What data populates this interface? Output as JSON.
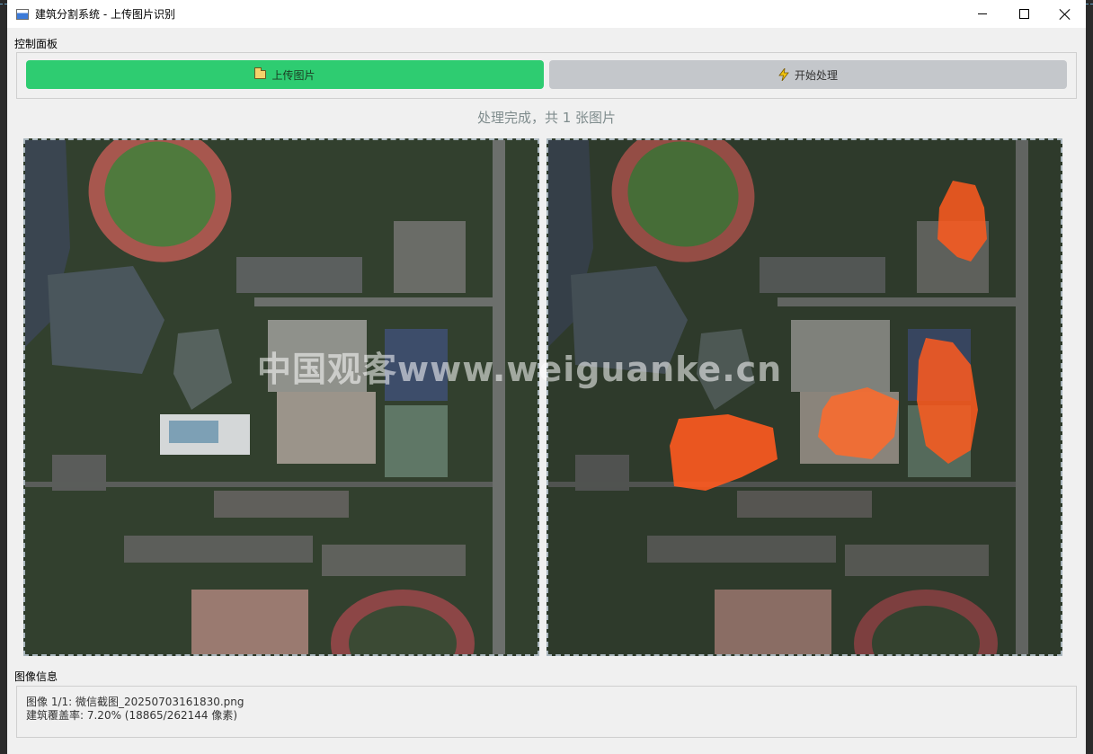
{
  "window": {
    "title": "建筑分割系统 - 上传图片识别",
    "minimize_glyph": "",
    "maximize_glyph": "",
    "close_glyph": ""
  },
  "control_panel": {
    "label": "控制面板",
    "upload_button": {
      "label": "上传图片",
      "icon": "folder-icon",
      "color": "#2ecc71"
    },
    "process_button": {
      "label": "开始处理",
      "icon": "lightning-icon",
      "color": "#c4c7cb"
    }
  },
  "status": {
    "text": "处理完成，共 1 张图片"
  },
  "images": {
    "original": {
      "kind": "satellite-image"
    },
    "segmented": {
      "kind": "satellite-image-with-building-overlay",
      "overlay_color": "#ff5a1f"
    }
  },
  "watermark": {
    "text": "中国观客www.weiguanke.cn"
  },
  "image_info": {
    "label": "图像信息",
    "line1": "图像 1/1: 微信截图_20250703161830.png",
    "line2": "建筑覆盖率: 7.20% (18865/262144 像素)"
  }
}
